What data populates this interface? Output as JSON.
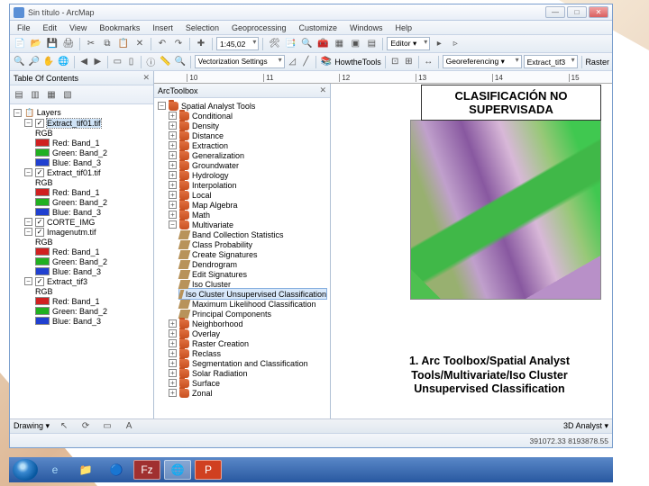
{
  "window": {
    "title": "Sin título - ArcMap"
  },
  "menu": [
    "File",
    "Edit",
    "View",
    "Bookmarks",
    "Insert",
    "Selection",
    "Geoprocessing",
    "Customize",
    "Windows",
    "Help"
  ],
  "toolbar1": {
    "scale": "1:45,02",
    "editor": "Editor ▾"
  },
  "toolbar2": {
    "vect": "Vectorization Settings",
    "howthe": "HowtheTools",
    "georef": "Georeferencing ▾",
    "georef_target": "Extract_tif3",
    "raster": "Raster"
  },
  "toc": {
    "title": "Table Of Contents",
    "layers": "Layers",
    "groups": [
      {
        "name": "Extract_tif01.tif",
        "sub": "RGB",
        "bands": [
          {
            "c": "#d02020",
            "l": "Red: Band_1"
          },
          {
            "c": "#20b020",
            "l": "Green: Band_2"
          },
          {
            "c": "#2040d0",
            "l": "Blue: Band_3"
          }
        ]
      },
      {
        "name": "Extract_tif01.tif",
        "sub": "RGB",
        "bands": [
          {
            "c": "#d02020",
            "l": "Red: Band_1"
          },
          {
            "c": "#20b020",
            "l": "Green: Band_2"
          },
          {
            "c": "#2040d0",
            "l": "Blue: Band_3"
          }
        ]
      },
      {
        "name": "CORTE_IMG",
        "sub": "",
        "bands": []
      },
      {
        "name": "Imagenutm.tif",
        "sub": "RGB",
        "bands": [
          {
            "c": "#d02020",
            "l": "Red: Band_1"
          },
          {
            "c": "#20b020",
            "l": "Green: Band_2"
          },
          {
            "c": "#2040d0",
            "l": "Blue: Band_3"
          }
        ]
      },
      {
        "name": "Extract_tif3",
        "sub": "RGB",
        "bands": [
          {
            "c": "#d02020",
            "l": "Red: Band_1"
          },
          {
            "c": "#20b020",
            "l": "Green: Band_2"
          },
          {
            "c": "#2040d0",
            "l": "Blue: Band_3"
          }
        ]
      }
    ]
  },
  "ruler": [
    "10",
    "11",
    "12",
    "13",
    "14",
    "15"
  ],
  "arctoolbox": {
    "title": "ArcToolbox",
    "root": "Spatial Analyst Tools",
    "folders": [
      "Conditional",
      "Density",
      "Distance",
      "Extraction",
      "Generalization",
      "Groundwater",
      "Hydrology",
      "Interpolation",
      "Local",
      "Map Algebra",
      "Math",
      "Multivariate",
      "Neighborhood",
      "Overlay",
      "Raster Creation",
      "Reclass",
      "Segmentation and Classification",
      "Solar Radiation",
      "Surface",
      "Zonal"
    ],
    "multivariate": [
      "Band Collection Statistics",
      "Class Probability",
      "Create Signatures",
      "Dendrogram",
      "Edit Signatures",
      "Iso Cluster",
      "Iso Cluster Unsupervised Classification",
      "Maximum Likelihood Classification",
      "Principal Components"
    ],
    "selected_idx": 6
  },
  "overlay1": "CLASIFICACIÓN NO SUPERVISADA",
  "overlay2": "1. Arc Toolbox/Spatial Analyst Tools/Multivariate/Iso Cluster Unsupervised Classification",
  "status": {
    "drawing": "Drawing ▾",
    "analyst3d": "3D Analyst ▾",
    "coords": "391072.33  8193878.55"
  }
}
